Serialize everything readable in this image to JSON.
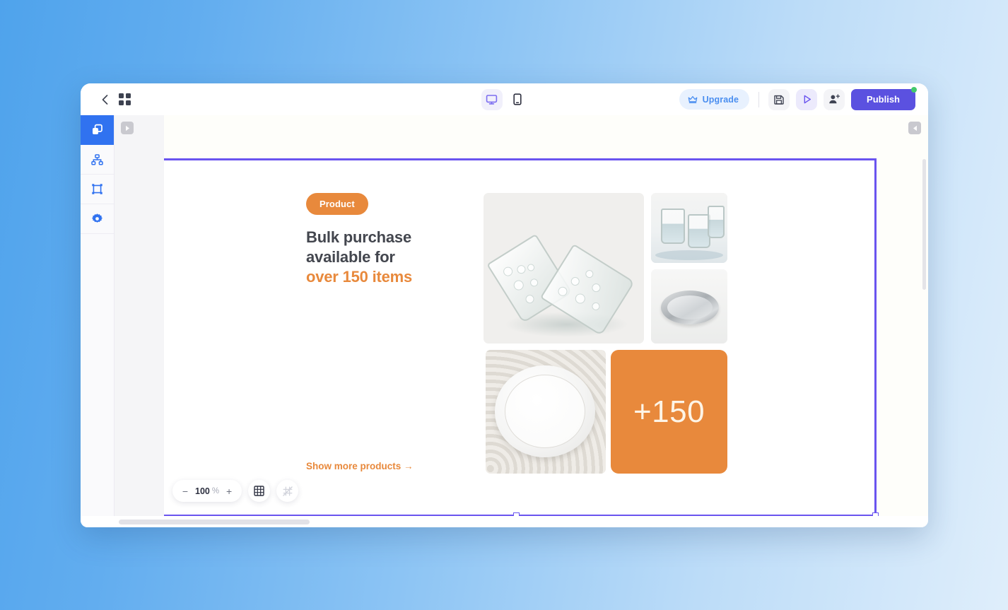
{
  "topbar": {
    "back_icon": "chevron-left-icon",
    "apps_icon": "grid-apps-icon",
    "device_desktop_icon": "desktop-icon",
    "device_mobile_icon": "mobile-icon",
    "upgrade_label": "Upgrade",
    "upgrade_icon": "crown-icon",
    "save_icon": "save-disk-icon",
    "preview_icon": "play-preview-icon",
    "invite_icon": "add-user-icon",
    "publish_label": "Publish"
  },
  "sidebar": {
    "items": [
      {
        "name": "layers",
        "icon": "layers-icon",
        "active": true
      },
      {
        "name": "sitemap",
        "icon": "sitemap-icon",
        "active": false
      },
      {
        "name": "frame",
        "icon": "crop-frame-icon",
        "active": false
      },
      {
        "name": "settings",
        "icon": "gear-icon",
        "active": false
      }
    ],
    "expand_icon": "triangle-right-icon"
  },
  "canvas": {
    "collapse_icon": "triangle-left-icon",
    "hero": {
      "badge": "Product",
      "title_line1": "Bulk purchase",
      "title_line2": "available for",
      "title_accent": "over 150 items",
      "link": "Show more products →",
      "count_card": "+150",
      "images": [
        {
          "name": "tilted-glasses-photo",
          "alt": "two tilted textured drinking glasses"
        },
        {
          "name": "water-glasses-photo",
          "alt": "glasses filled with water"
        },
        {
          "name": "metal-tray-photo",
          "alt": "round stainless steel tray"
        },
        {
          "name": "white-plate-photo",
          "alt": "white ceramic dinner plate"
        }
      ]
    }
  },
  "element_toolbar": {
    "buttons": [
      {
        "name": "move-up",
        "icon": "chevron-up-icon"
      },
      {
        "name": "move-down",
        "icon": "chevron-down-icon"
      },
      {
        "name": "add",
        "icon": "plus-icon"
      },
      {
        "name": "duplicate",
        "icon": "duplicate-icon"
      },
      {
        "name": "delete",
        "icon": "trash-icon"
      }
    ]
  },
  "zoombar": {
    "minus": "−",
    "value": "100",
    "percent": "%",
    "plus": "+",
    "grid_icon": "grid-icon",
    "snap_icon": "snap-off-icon"
  },
  "colors": {
    "accent_orange": "#e8893c",
    "publish_purple": "#5b51e0",
    "rail_blue": "#3072f0",
    "selection_purple": "#6a54ef",
    "upgrade_blue": "#4a8ef0",
    "bg_gradient_from": "#4fa3ec",
    "bg_gradient_to": "#dfeefb"
  }
}
